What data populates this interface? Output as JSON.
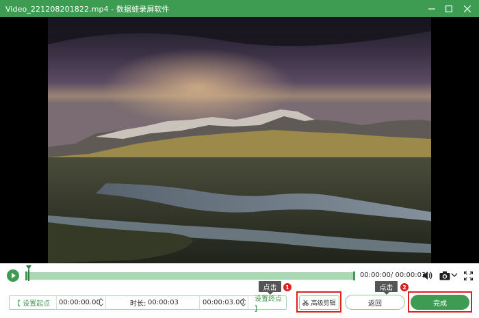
{
  "window": {
    "title": "Video_221208201822.mp4  -  数据蛙录屏软件",
    "accent_color": "#3e9b52"
  },
  "player": {
    "time_display": "00:00:00/ 00:00:03",
    "progress": 0.0,
    "icons": [
      "play-icon",
      "volume-icon",
      "camera-icon",
      "chevron-down-icon",
      "fullscreen-icon"
    ]
  },
  "edit_bar": {
    "set_start_label": "【 设置起点",
    "start_time": "00:00:00.00",
    "duration_label": "时长:",
    "duration_value": "00:00:03",
    "end_time": "00:00:03.00",
    "set_end_label": "设置终点 】"
  },
  "buttons": {
    "advanced_edit": "高级剪辑",
    "back": "返回",
    "done": "完成"
  },
  "annotations": [
    {
      "label": "点击",
      "number": "1"
    },
    {
      "label": "点击",
      "number": "2"
    }
  ]
}
